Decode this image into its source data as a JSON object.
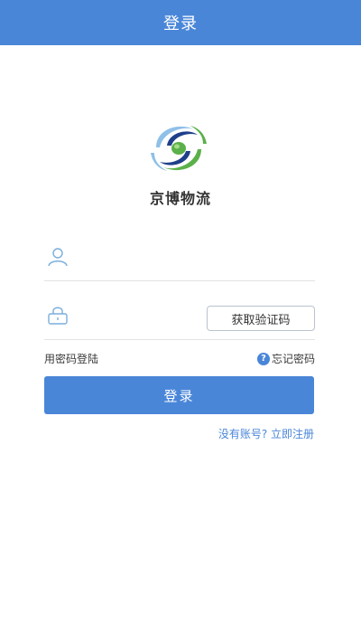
{
  "header": {
    "title": "登录"
  },
  "brand": {
    "name": "京博物流"
  },
  "login_form": {
    "username": {
      "value": "",
      "placeholder": ""
    },
    "code": {
      "value": "",
      "placeholder": ""
    },
    "get_code_label": "获取验证码",
    "password_login_label": "用密码登陆",
    "forgot_label": "忘记密码",
    "help_symbol": "?",
    "submit_label": "登录",
    "register_label": "没有账号? 立即注册"
  },
  "icons": {
    "logo": "brand-swirl-logo",
    "user": "user-icon",
    "lock": "lock-icon",
    "help": "question-circle-icon"
  },
  "colors": {
    "primary": "#4a86d8",
    "logo_green": "#5bb04a",
    "logo_navy": "#1f3f8a",
    "logo_light_blue": "#8fc0e8",
    "icon_blue": "#7aaedb"
  }
}
